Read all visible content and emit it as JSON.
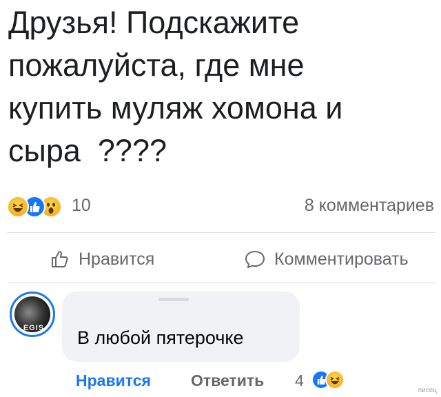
{
  "post": {
    "text": "Друзья! Подскажите\nпожалуйста, где мне\nкупить муляж хомона и\nсыра  ????"
  },
  "reactions": {
    "count": "10",
    "icons": [
      "haha-icon",
      "like-icon",
      "wow-icon"
    ],
    "comments_label": "8 комментариев"
  },
  "actions": {
    "like_label": "Нравится",
    "comment_label": "Комментировать"
  },
  "comment": {
    "avatar_tag": "EGIS",
    "text": "В любой пятерочке",
    "like_label": "Нравится",
    "reply_label": "Ответить",
    "reaction_count": "4",
    "reaction_icons": [
      "like-icon",
      "haha-icon"
    ]
  },
  "watermark": "писец",
  "colors": {
    "accent": "#1877f2",
    "muted": "#65676b",
    "bubble": "#f0f2f5",
    "divider": "#dadde1"
  }
}
